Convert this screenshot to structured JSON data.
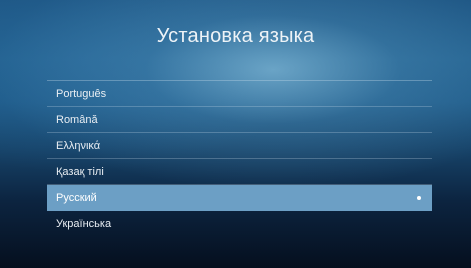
{
  "header": {
    "title": "Установка языка"
  },
  "language_list": {
    "items": [
      {
        "label": "Português",
        "selected": false
      },
      {
        "label": "Română",
        "selected": false
      },
      {
        "label": "Ελληνικά",
        "selected": false
      },
      {
        "label": "Қазақ тілі",
        "selected": false
      },
      {
        "label": "Русский",
        "selected": true
      },
      {
        "label": "Українська",
        "selected": false
      }
    ],
    "selected_label": "Русский"
  },
  "colors": {
    "selection": "#6c9fc5",
    "text": "#e9eef3",
    "background_top": "#1d5583",
    "background_bottom": "#050f1e"
  },
  "icons": {
    "selected_marker": "selected-dot-icon"
  }
}
